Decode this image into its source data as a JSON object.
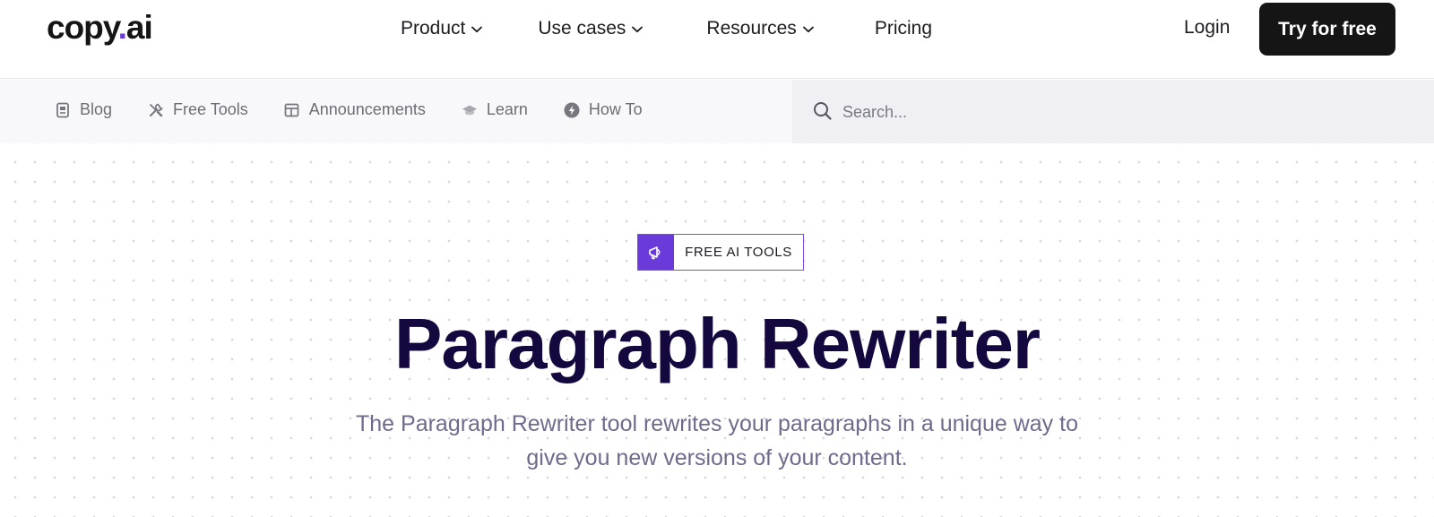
{
  "brand": {
    "logo_prefix": "copy",
    "logo_dot": ".",
    "logo_suffix": "ai",
    "accent": "#6a3bd9"
  },
  "nav": {
    "items": [
      {
        "label": "Product",
        "has_dropdown": true
      },
      {
        "label": "Use cases",
        "has_dropdown": true
      },
      {
        "label": "Resources",
        "has_dropdown": true
      },
      {
        "label": "Pricing",
        "has_dropdown": false
      }
    ],
    "login": "Login",
    "cta": "Try for free"
  },
  "subnav": {
    "items": [
      {
        "label": "Blog",
        "icon": "document-icon"
      },
      {
        "label": "Free Tools",
        "icon": "tools-icon"
      },
      {
        "label": "Announcements",
        "icon": "layout-icon"
      },
      {
        "label": "Learn",
        "icon": "graduation-cap-icon"
      },
      {
        "label": "How To",
        "icon": "lightning-icon"
      }
    ],
    "search": {
      "placeholder": "Search...",
      "value": ""
    }
  },
  "hero": {
    "badge_icon": "megaphone-icon",
    "badge_label": "FREE AI TOOLS",
    "title": "Paragraph Rewriter",
    "subtitle_line1": "The Paragraph Rewriter tool rewrites your paragraphs in a unique way to",
    "subtitle_line2": "give you new versions of your content."
  }
}
